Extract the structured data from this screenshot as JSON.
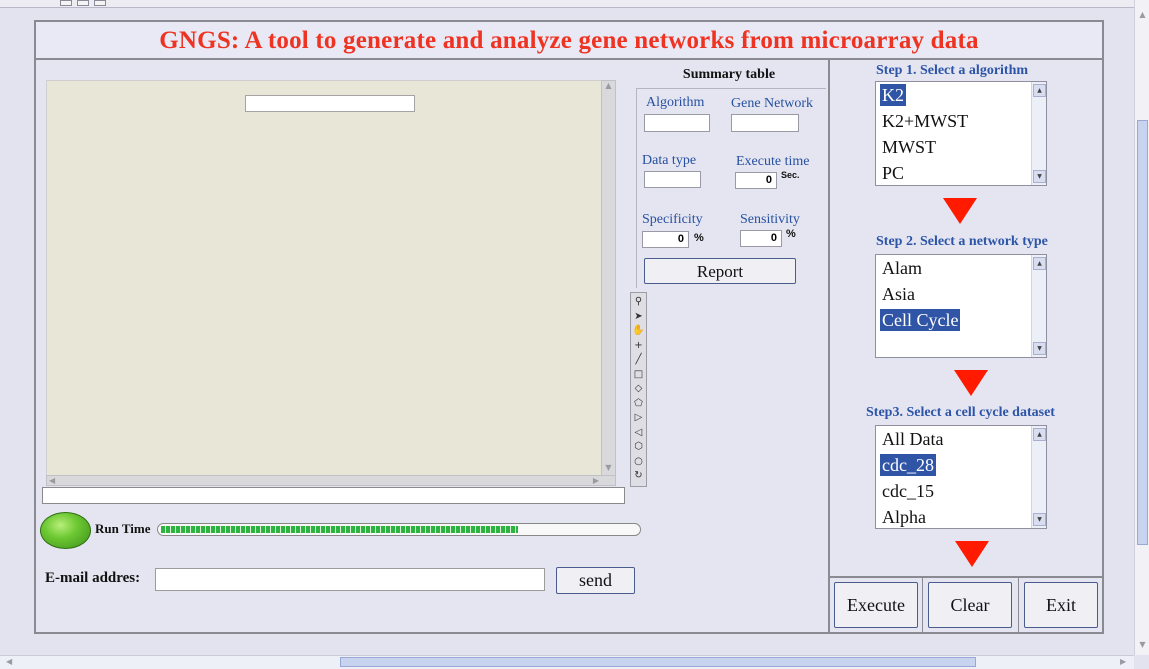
{
  "title": "GNGS: A tool to generate and analyze gene networks from microarray data",
  "summary": {
    "title": "Summary table",
    "algorithm_label": "Algorithm",
    "gene_network_label": "Gene Network",
    "data_type_label": "Data type",
    "execute_time_label": "Execute time",
    "execute_time_value": "0",
    "execute_time_unit": "Sec.",
    "specificity_label": "Specificity",
    "specificity_value": "0",
    "specificity_unit": "%",
    "sensitivity_label": "Sensitivity",
    "sensitivity_value": "0",
    "sensitivity_unit": "%",
    "report_button": "Report"
  },
  "toolbar_icons": [
    "zoom-icon",
    "select-arrow-icon",
    "hand-pan-icon",
    "crosshair-icon",
    "line-icon",
    "rectangle-icon",
    "diamond-icon",
    "polygon-icon",
    "delay-shape-icon",
    "cursor-shape-icon",
    "hexagon-icon",
    "circle-icon",
    "rotate-icon"
  ],
  "run": {
    "label": "Run Time",
    "progress": 0.75
  },
  "email": {
    "label": "E-mail addres:",
    "value": "",
    "send_button": "send"
  },
  "step1": {
    "label": "Step 1. Select a algorithm",
    "options": [
      "K2",
      "K2+MWST",
      "MWST",
      "PC"
    ],
    "selected": 0
  },
  "step2": {
    "label": "Step 2. Select a network type",
    "options": [
      "Alam",
      "Asia",
      "Cell Cycle"
    ],
    "selected": 2
  },
  "step3": {
    "label": "Step3. Select a cell cycle dataset",
    "options": [
      "All Data",
      "cdc_28",
      "cdc_15",
      "Alpha"
    ],
    "selected": 1
  },
  "actions": {
    "execute": "Execute",
    "clear": "Clear",
    "exit": "Exit"
  },
  "colors": {
    "title": "#ee3322",
    "step_label": "#2c55a7",
    "summary_label": "#2650a0",
    "selection": "#3155a6",
    "flow_arrow": "#ff1a00",
    "led": "#6cc832"
  }
}
